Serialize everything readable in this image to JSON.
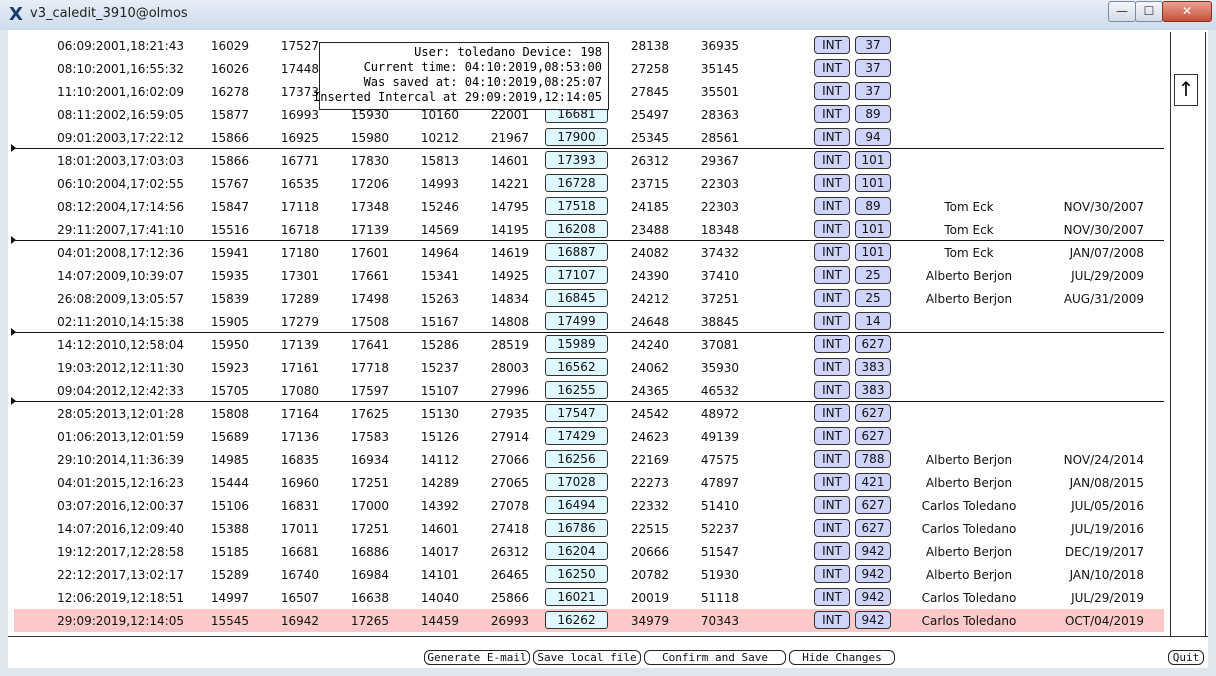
{
  "window": {
    "title": "v3_caledit_3910@olmos",
    "icon": "x-icon",
    "min_label": "—",
    "max_label": "☐",
    "close_label": "✕"
  },
  "tooltip": {
    "line1": "User: toledano Device: 198",
    "line2": "Current time: 04:10:2019,08:53:00",
    "line3": "Was saved at: 04:10:2019,08:25:07",
    "line4": "Inserted Intercal at 29:09:2019,12:14:05"
  },
  "rows": [
    {
      "date": "06:09:2001,18:21:43",
      "n1": "16029",
      "n2": "17527",
      "n3": "",
      "n4": "",
      "n5": "",
      "box": "",
      "n6": "28138",
      "n7": "36935",
      "int": "INT",
      "code": "37",
      "name": "",
      "saved": ""
    },
    {
      "date": "08:10:2001,16:55:32",
      "n1": "16026",
      "n2": "17448",
      "n3": "",
      "n4": "",
      "n5": "",
      "box": "",
      "n6": "27258",
      "n7": "35145",
      "int": "INT",
      "code": "37",
      "name": "",
      "saved": ""
    },
    {
      "date": "11:10:2001,16:02:09",
      "n1": "16278",
      "n2": "17373",
      "n3": "",
      "n4": "",
      "n5": "",
      "box": "",
      "n6": "27845",
      "n7": "35501",
      "int": "INT",
      "code": "37",
      "name": "",
      "saved": ""
    },
    {
      "date": "08:11:2002,16:59:05",
      "n1": "15877",
      "n2": "16993",
      "n3": "15930",
      "n4": "10160",
      "n5": "22001",
      "box": "16681",
      "n6": "25497",
      "n7": "28363",
      "int": "INT",
      "code": "89",
      "name": "",
      "saved": ""
    },
    {
      "date": "09:01:2003,17:22:12",
      "n1": "15866",
      "n2": "16925",
      "n3": "15980",
      "n4": "10212",
      "n5": "21967",
      "box": "17900",
      "n6": "25345",
      "n7": "28561",
      "int": "INT",
      "code": "94",
      "name": "",
      "saved": ""
    },
    {
      "date": "18:01:2003,17:03:03",
      "n1": "15866",
      "n2": "16771",
      "n3": "17830",
      "n4": "15813",
      "n5": "14601",
      "box": "17393",
      "n6": "26312",
      "n7": "29367",
      "int": "INT",
      "code": "101",
      "name": "",
      "saved": ""
    },
    {
      "date": "06:10:2004,17:02:55",
      "n1": "15767",
      "n2": "16535",
      "n3": "17206",
      "n4": "14993",
      "n5": "14221",
      "box": "16728",
      "n6": "23715",
      "n7": "22303",
      "int": "INT",
      "code": "101",
      "name": "",
      "saved": ""
    },
    {
      "date": "08:12:2004,17:14:56",
      "n1": "15847",
      "n2": "17118",
      "n3": "17348",
      "n4": "15246",
      "n5": "14795",
      "box": "17518",
      "n6": "24185",
      "n7": "22303",
      "int": "INT",
      "code": "89",
      "name": "Tom Eck",
      "saved": "NOV/30/2007"
    },
    {
      "date": "29:11:2007,17:41:10",
      "n1": "15516",
      "n2": "16718",
      "n3": "17139",
      "n4": "14569",
      "n5": "14195",
      "box": "16208",
      "n6": "23488",
      "n7": "18348",
      "int": "INT",
      "code": "101",
      "name": "Tom Eck",
      "saved": "NOV/30/2007"
    },
    {
      "date": "04:01:2008,17:12:36",
      "n1": "15941",
      "n2": "17180",
      "n3": "17601",
      "n4": "14964",
      "n5": "14619",
      "box": "16887",
      "n6": "24082",
      "n7": "37432",
      "int": "INT",
      "code": "101",
      "name": "Tom Eck",
      "saved": "JAN/07/2008"
    },
    {
      "date": "14:07:2009,10:39:07",
      "n1": "15935",
      "n2": "17301",
      "n3": "17661",
      "n4": "15341",
      "n5": "14925",
      "box": "17107",
      "n6": "24390",
      "n7": "37410",
      "int": "INT",
      "code": "25",
      "name": "Alberto Berjon",
      "saved": "JUL/29/2009"
    },
    {
      "date": "26:08:2009,13:05:57",
      "n1": "15839",
      "n2": "17289",
      "n3": "17498",
      "n4": "15263",
      "n5": "14834",
      "box": "16845",
      "n6": "24212",
      "n7": "37251",
      "int": "INT",
      "code": "25",
      "name": "Alberto Berjon",
      "saved": "AUG/31/2009"
    },
    {
      "date": "02:11:2010,14:15:38",
      "n1": "15905",
      "n2": "17279",
      "n3": "17508",
      "n4": "15167",
      "n5": "14808",
      "box": "17499",
      "n6": "24648",
      "n7": "38845",
      "int": "INT",
      "code": "14",
      "name": "",
      "saved": ""
    },
    {
      "date": "14:12:2010,12:58:04",
      "n1": "15950",
      "n2": "17139",
      "n3": "17641",
      "n4": "15286",
      "n5": "28519",
      "box": "15989",
      "n6": "24240",
      "n7": "37081",
      "int": "INT",
      "code": "627",
      "name": "",
      "saved": ""
    },
    {
      "date": "19:03:2012,12:11:30",
      "n1": "15923",
      "n2": "17161",
      "n3": "17718",
      "n4": "15237",
      "n5": "28003",
      "box": "16562",
      "n6": "24062",
      "n7": "35930",
      "int": "INT",
      "code": "383",
      "name": "",
      "saved": ""
    },
    {
      "date": "09:04:2012,12:42:33",
      "n1": "15705",
      "n2": "17080",
      "n3": "17597",
      "n4": "15107",
      "n5": "27996",
      "box": "16255",
      "n6": "24365",
      "n7": "46532",
      "int": "INT",
      "code": "383",
      "name": "",
      "saved": ""
    },
    {
      "date": "28:05:2013,12:01:28",
      "n1": "15808",
      "n2": "17164",
      "n3": "17625",
      "n4": "15130",
      "n5": "27935",
      "box": "17547",
      "n6": "24542",
      "n7": "48972",
      "int": "INT",
      "code": "627",
      "name": "",
      "saved": ""
    },
    {
      "date": "01:06:2013,12:01:59",
      "n1": "15689",
      "n2": "17136",
      "n3": "17583",
      "n4": "15126",
      "n5": "27914",
      "box": "17429",
      "n6": "24623",
      "n7": "49139",
      "int": "INT",
      "code": "627",
      "name": "",
      "saved": ""
    },
    {
      "date": "29:10:2014,11:36:39",
      "n1": "14985",
      "n2": "16835",
      "n3": "16934",
      "n4": "14112",
      "n5": "27066",
      "box": "16256",
      "n6": "22169",
      "n7": "47575",
      "int": "INT",
      "code": "788",
      "name": "Alberto Berjon",
      "saved": "NOV/24/2014"
    },
    {
      "date": "04:01:2015,12:16:23",
      "n1": "15444",
      "n2": "16960",
      "n3": "17251",
      "n4": "14289",
      "n5": "27065",
      "box": "17028",
      "n6": "22273",
      "n7": "47897",
      "int": "INT",
      "code": "421",
      "name": "Alberto Berjon",
      "saved": "JAN/08/2015"
    },
    {
      "date": "03:07:2016,12:00:37",
      "n1": "15106",
      "n2": "16831",
      "n3": "17000",
      "n4": "14392",
      "n5": "27078",
      "box": "16494",
      "n6": "22332",
      "n7": "51410",
      "int": "INT",
      "code": "627",
      "name": "Carlos Toledano",
      "saved": "JUL/05/2016"
    },
    {
      "date": "14:07:2016,12:09:40",
      "n1": "15388",
      "n2": "17011",
      "n3": "17251",
      "n4": "14601",
      "n5": "27418",
      "box": "16786",
      "n6": "22515",
      "n7": "52237",
      "int": "INT",
      "code": "627",
      "name": "Carlos Toledano",
      "saved": "JUL/19/2016"
    },
    {
      "date": "19:12:2017,12:28:58",
      "n1": "15185",
      "n2": "16681",
      "n3": "16886",
      "n4": "14017",
      "n5": "26312",
      "box": "16204",
      "n6": "20666",
      "n7": "51547",
      "int": "INT",
      "code": "942",
      "name": "Alberto Berjon",
      "saved": "DEC/19/2017"
    },
    {
      "date": "22:12:2017,13:02:17",
      "n1": "15289",
      "n2": "16740",
      "n3": "16984",
      "n4": "14101",
      "n5": "26465",
      "box": "16250",
      "n6": "20782",
      "n7": "51930",
      "int": "INT",
      "code": "942",
      "name": "Alberto Berjon",
      "saved": "JAN/10/2018"
    },
    {
      "date": "12:06:2019,12:18:51",
      "n1": "14997",
      "n2": "16507",
      "n3": "16638",
      "n4": "14040",
      "n5": "25866",
      "box": "16021",
      "n6": "20019",
      "n7": "51118",
      "int": "INT",
      "code": "942",
      "name": "Carlos Toledano",
      "saved": "JUL/29/2019"
    },
    {
      "date": "29:09:2019,12:14:05",
      "n1": "15545",
      "n2": "16942",
      "n3": "17265",
      "n4": "14459",
      "n5": "26993",
      "box": "16262",
      "n6": "34979",
      "n7": "70343",
      "int": "INT",
      "code": "942",
      "name": "Carlos Toledano",
      "saved": "OCT/04/2019",
      "highlight": true
    }
  ],
  "separators_after_rows": [
    4,
    8,
    12,
    15
  ],
  "scrollbar": {
    "arrow": "↑"
  },
  "buttons": {
    "email": "Generate E-mail",
    "save_local": "Save local file",
    "confirm": "Confirm and Save",
    "hide": "Hide Changes",
    "quit": "Quit"
  },
  "colors": {
    "highlight_row": "#fcc8c8",
    "value_box": "#dff8ff",
    "tag_box": "#cfd4fb"
  }
}
